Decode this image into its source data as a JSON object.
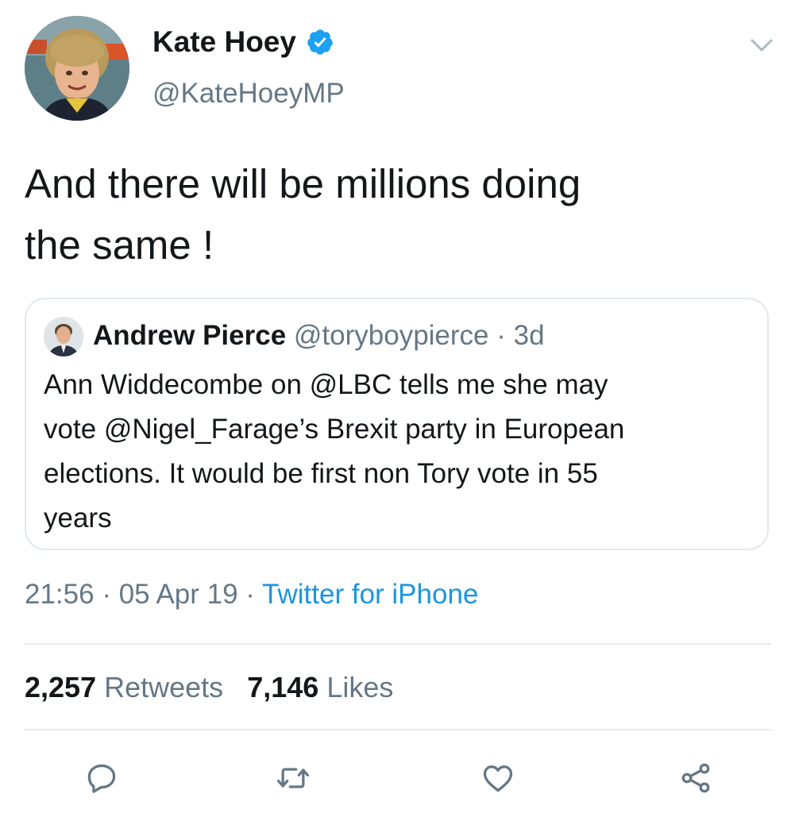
{
  "author": {
    "name": "Kate Hoey",
    "handle": "@KateHoeyMP",
    "verified_color": "#1da1f2"
  },
  "tweet": {
    "text_line1": "And there will be millions doing",
    "text_line2": "the same !"
  },
  "quoted_tweet": {
    "name": "Andrew Pierce",
    "handle": "@toryboypierce",
    "separator": "·",
    "time": "3d",
    "text_line1": "Ann Widdecombe on @LBC tells me she may",
    "text_line2": "vote @Nigel_Farage’s Brexit party in European",
    "text_line3": "elections. It would be first non Tory vote in 55",
    "text_line4": "years"
  },
  "meta": {
    "time": "21:56",
    "sep1": "·",
    "date": "05 Apr 19",
    "sep2": "·",
    "source": "Twitter for iPhone"
  },
  "stats": {
    "retweets_count": "2,257",
    "retweets_label": "Retweets",
    "likes_count": "7,146",
    "likes_label": "Likes"
  },
  "icons": {
    "reply": "reply-icon",
    "retweet": "retweet-icon",
    "like": "heart-icon",
    "share": "share-icon",
    "menu": "chevron-down-icon"
  },
  "colors": {
    "text": "#14171a",
    "secondary": "#657786",
    "link": "#1b95e0",
    "border": "#e1e8ed"
  }
}
